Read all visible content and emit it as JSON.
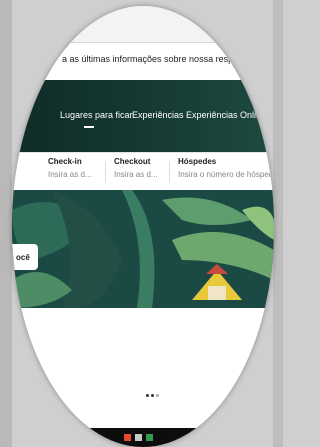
{
  "banner": {
    "covid_text": "a as últimas informações sobre nossa resposta à COVID"
  },
  "nav": {
    "items": [
      {
        "label": "Lugares para ficar",
        "active": true
      },
      {
        "label": "Experiências",
        "active": false
      },
      {
        "label": "Experiências Online",
        "active": false
      }
    ]
  },
  "search": {
    "checkin_label": "Check-in",
    "checkin_placeholder": "Insira as d...",
    "checkout_label": "Checkout",
    "checkout_placeholder": "Insira as d...",
    "guests_label": "Hóspedes",
    "guests_placeholder": "Insira o número de hóspedes"
  },
  "hero": {
    "partial_text": "ocê"
  },
  "carousel": {
    "dots": 3,
    "active_index": 1
  },
  "colors": {
    "hero_dark": "#0f2b27",
    "accent_yellow": "#e7c93a"
  }
}
